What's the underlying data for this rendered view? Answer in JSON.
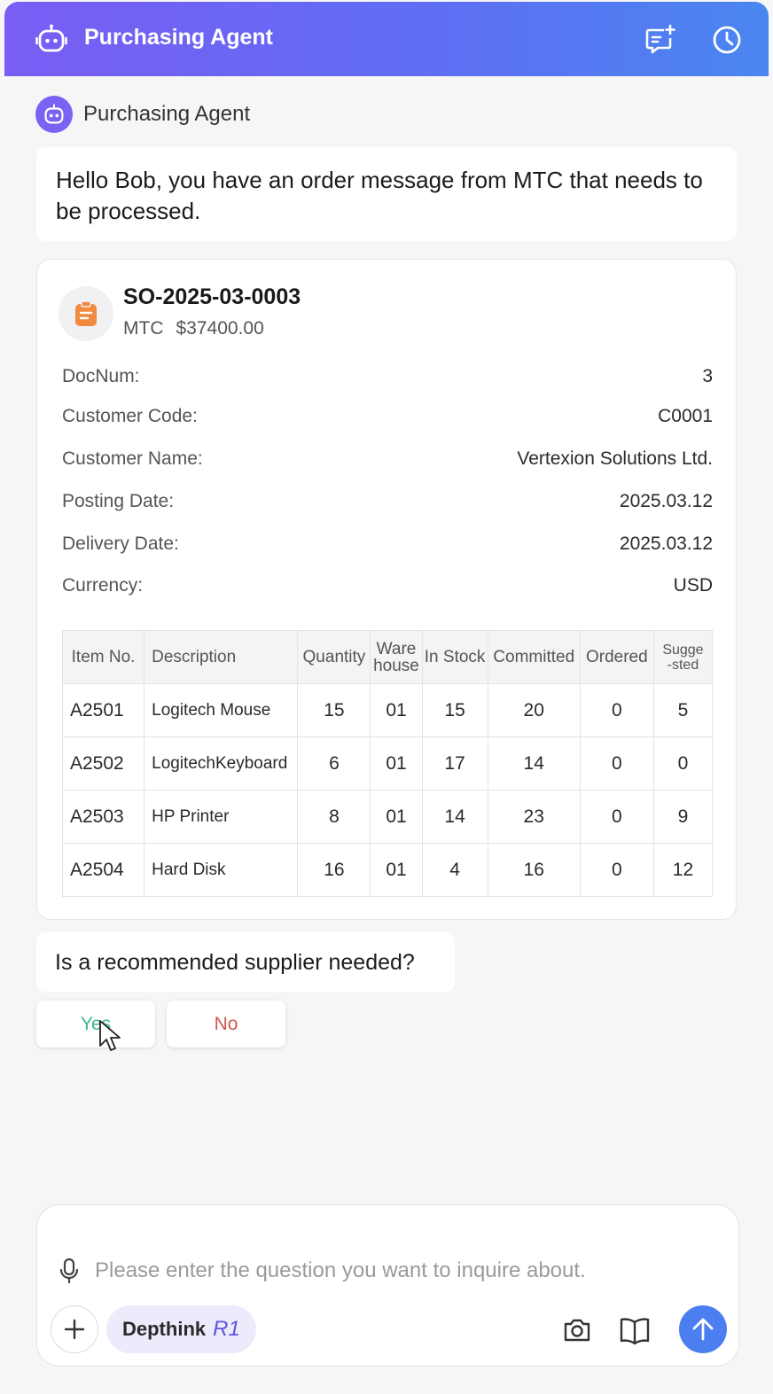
{
  "header": {
    "title": "Purchasing Agent"
  },
  "agent": {
    "name": "Purchasing Agent"
  },
  "messages": {
    "greeting": "Hello Bob, you have an order message from MTC that needs to be processed.",
    "question": "Is a recommended supplier needed?"
  },
  "order": {
    "number": "SO-2025-03-0003",
    "customer_short": "MTC",
    "amount": "$37400.00",
    "fields": [
      {
        "label": "DocNum:",
        "value": "3"
      },
      {
        "label": "Customer Code:",
        "value": "C0001"
      },
      {
        "label": "Customer Name:",
        "value": "Vertexion Solutions Ltd."
      },
      {
        "label": "Posting Date:",
        "value": "2025.03.12"
      },
      {
        "label": "Delivery Date:",
        "value": "2025.03.12"
      },
      {
        "label": "Currency:",
        "value": "USD"
      }
    ],
    "table": {
      "headers": [
        "Item No.",
        "Description",
        "Quantity",
        "Ware\nhouse",
        "In Stock",
        "Committed",
        "Ordered",
        "Sugge\n-sted"
      ],
      "rows": [
        [
          "A2501",
          "Logitech Mouse",
          "15",
          "01",
          "15",
          "20",
          "0",
          "5"
        ],
        [
          "A2502",
          "LogitechKeyboard",
          "6",
          "01",
          "17",
          "14",
          "0",
          "0"
        ],
        [
          "A2503",
          "HP Printer",
          "8",
          "01",
          "14",
          "23",
          "0",
          "9"
        ],
        [
          "A2504",
          "Hard Disk",
          "16",
          "01",
          "4",
          "16",
          "0",
          "12"
        ]
      ]
    }
  },
  "choices": {
    "yes": "Yes",
    "no": "No"
  },
  "composer": {
    "placeholder": "Please enter the question you want to inquire about.",
    "value": "",
    "mode_label": "Depthink",
    "mode_badge": "R1"
  },
  "colors": {
    "header_gradient_start": "#7a5df4",
    "header_gradient_end": "#4a86f0",
    "yes_text": "#3fb68a",
    "no_text": "#d2554e",
    "send_button": "#4b7ef0",
    "order_icon": "#f08a3e"
  },
  "icons": {
    "header_left": "robot-icon",
    "header_new_chat": "new-chat-icon",
    "header_history": "clock-icon",
    "order": "clipboard-icon",
    "mic": "microphone-icon",
    "plus": "plus-icon",
    "camera": "camera-icon",
    "book": "book-icon",
    "send": "arrow-up-icon"
  }
}
